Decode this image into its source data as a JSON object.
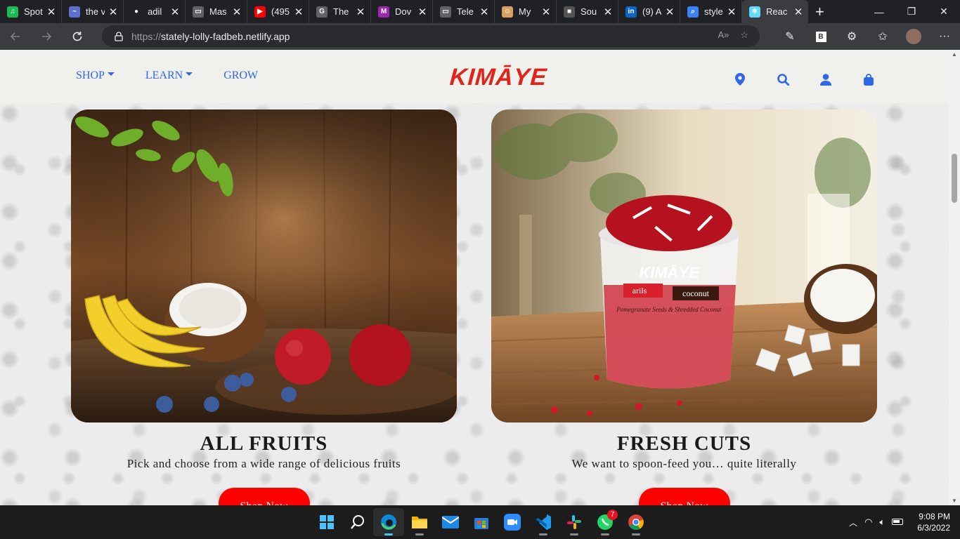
{
  "browser": {
    "tabs": [
      {
        "title": "Spot",
        "icon": "spotify-icon",
        "color": "#1db954",
        "glyph": "♫"
      },
      {
        "title": "the v",
        "icon": "site-icon",
        "color": "#5f6fd0",
        "glyph": "~"
      },
      {
        "title": "adil",
        "icon": "github-icon",
        "color": "#ffffff",
        "glyph": "●"
      },
      {
        "title": "Mas",
        "icon": "page-icon",
        "color": "#5f6368",
        "glyph": "▭"
      },
      {
        "title": "(495",
        "icon": "youtube-icon",
        "color": "#ff0000",
        "glyph": "▶"
      },
      {
        "title": "The",
        "icon": "g-icon",
        "color": "#5f6368",
        "glyph": "G"
      },
      {
        "title": "Dov",
        "icon": "m-icon",
        "color": "#9c27b0",
        "glyph": "M"
      },
      {
        "title": "Tele",
        "icon": "page-icon",
        "color": "#5f6368",
        "glyph": "▭"
      },
      {
        "title": "My",
        "icon": "avatar-icon",
        "color": "#d9a066",
        "glyph": "☺"
      },
      {
        "title": "Sou",
        "icon": "person-icon",
        "color": "#555555",
        "glyph": "■"
      },
      {
        "title": "(9) A",
        "icon": "linkedin-icon",
        "color": "#0a66c2",
        "glyph": "in"
      },
      {
        "title": "style",
        "icon": "search-icon",
        "color": "#3a82f7",
        "glyph": "⌕"
      },
      {
        "title": "Reac",
        "icon": "react-icon",
        "color": "#61dafb",
        "glyph": "⚛"
      }
    ],
    "url_scheme": "https://",
    "url_host": "stately-lolly-fadbeb.netlify.app"
  },
  "site": {
    "nav": [
      {
        "label": "SHOP",
        "dropdown": true
      },
      {
        "label": "LEARN",
        "dropdown": true
      },
      {
        "label": "GROW",
        "dropdown": false
      }
    ],
    "logo": "KIMĀYE",
    "brand_red": "#e2231a",
    "link_blue": "#2f67e6"
  },
  "cards": [
    {
      "title": "ALL FRUITS",
      "subtitle": "Pick and choose from a wide range of delicious fruits",
      "button": "Shop Now"
    },
    {
      "title": "FRESH CUTS",
      "subtitle": "We want to spoon-feed you… quite literally",
      "button": "Shop Now"
    }
  ],
  "product_cup": {
    "brand": "KIMĀYE",
    "tag1": "arils",
    "tag2": "coconut",
    "desc": "Pomegranate Seeds & Shredded Coconut"
  },
  "taskbar": {
    "apps": [
      {
        "name": "windows-start-icon",
        "badge": ""
      },
      {
        "name": "search-icon",
        "badge": ""
      },
      {
        "name": "edge-icon",
        "badge": ""
      },
      {
        "name": "file-explorer-icon",
        "badge": ""
      },
      {
        "name": "mail-icon",
        "badge": ""
      },
      {
        "name": "store-icon",
        "badge": ""
      },
      {
        "name": "zoom-icon",
        "badge": ""
      },
      {
        "name": "vscode-icon",
        "badge": ""
      },
      {
        "name": "slack-icon",
        "badge": ""
      },
      {
        "name": "whatsapp-icon",
        "badge": "7"
      },
      {
        "name": "chrome-icon",
        "badge": ""
      }
    ],
    "time": "9:08 PM",
    "date": "6/3/2022"
  }
}
